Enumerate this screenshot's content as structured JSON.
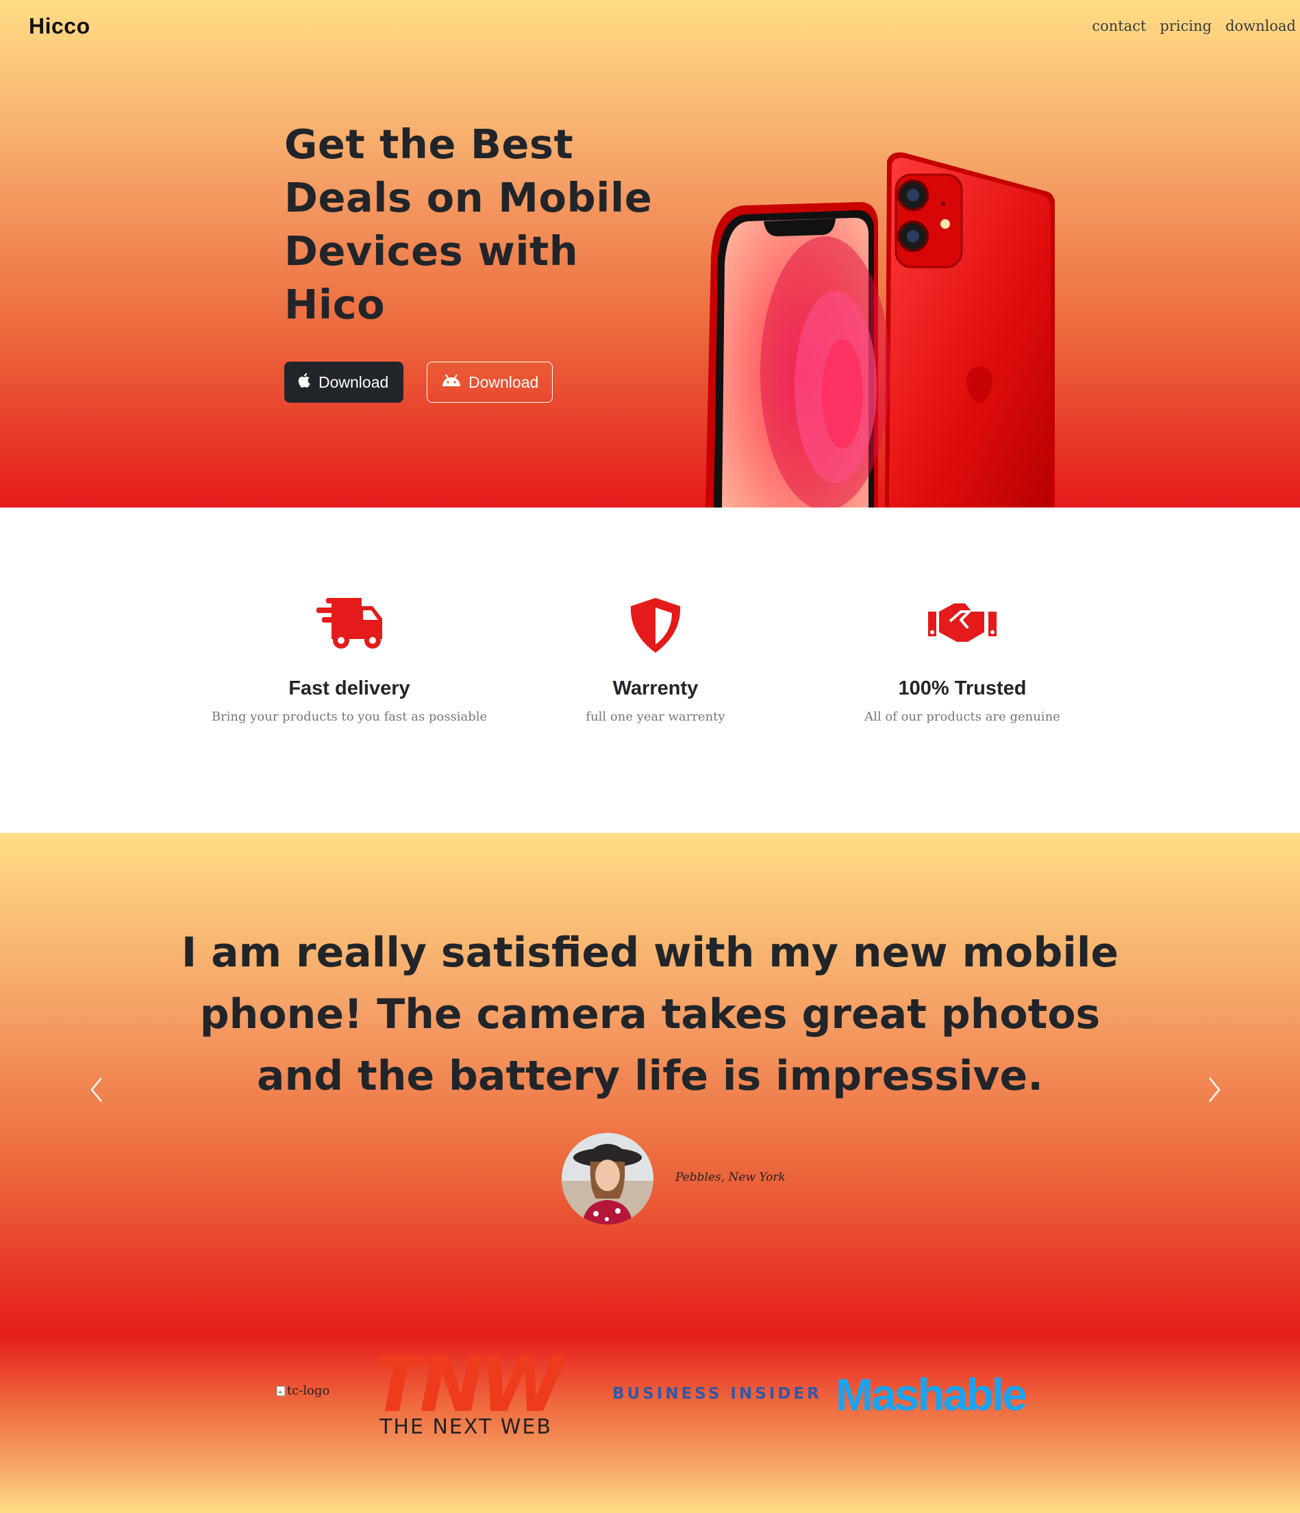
{
  "header": {
    "brand": "Hicco",
    "nav": [
      "contact",
      "pricing",
      "download"
    ]
  },
  "hero": {
    "headline": "Get the Best Deals on Mobile Devices with Hico",
    "buttons": [
      {
        "label": "Download",
        "icon": "apple-icon"
      },
      {
        "label": "Download",
        "icon": "android-icon"
      }
    ]
  },
  "features": [
    {
      "icon": "truck-icon",
      "title": "Fast delivery",
      "text": "Bring your products to you fast as possiable"
    },
    {
      "icon": "shield-icon",
      "title": "Warrenty",
      "text": "full one year warrenty"
    },
    {
      "icon": "handshake-icon",
      "title": "100% Trusted",
      "text": "All of our products are genuine"
    }
  ],
  "testimonial": {
    "quote": "I am really satisfied with my new mobile phone! The camera takes great photos and the battery life is impressive.",
    "author": "Pebbles, New York"
  },
  "press": {
    "tc_alt": "tc-logo",
    "tnw_mark": "TNW",
    "tnw_name": "THE NEXT WEB",
    "business_insider": "BUSINESS INSIDER",
    "mashable": "Mashable"
  },
  "colors": {
    "accent_red": "#e51a1a",
    "gradient_top": "#ffdd85",
    "dark": "#212529",
    "mashable_blue": "#1aa3f0",
    "bi_blue": "#3357a6"
  }
}
